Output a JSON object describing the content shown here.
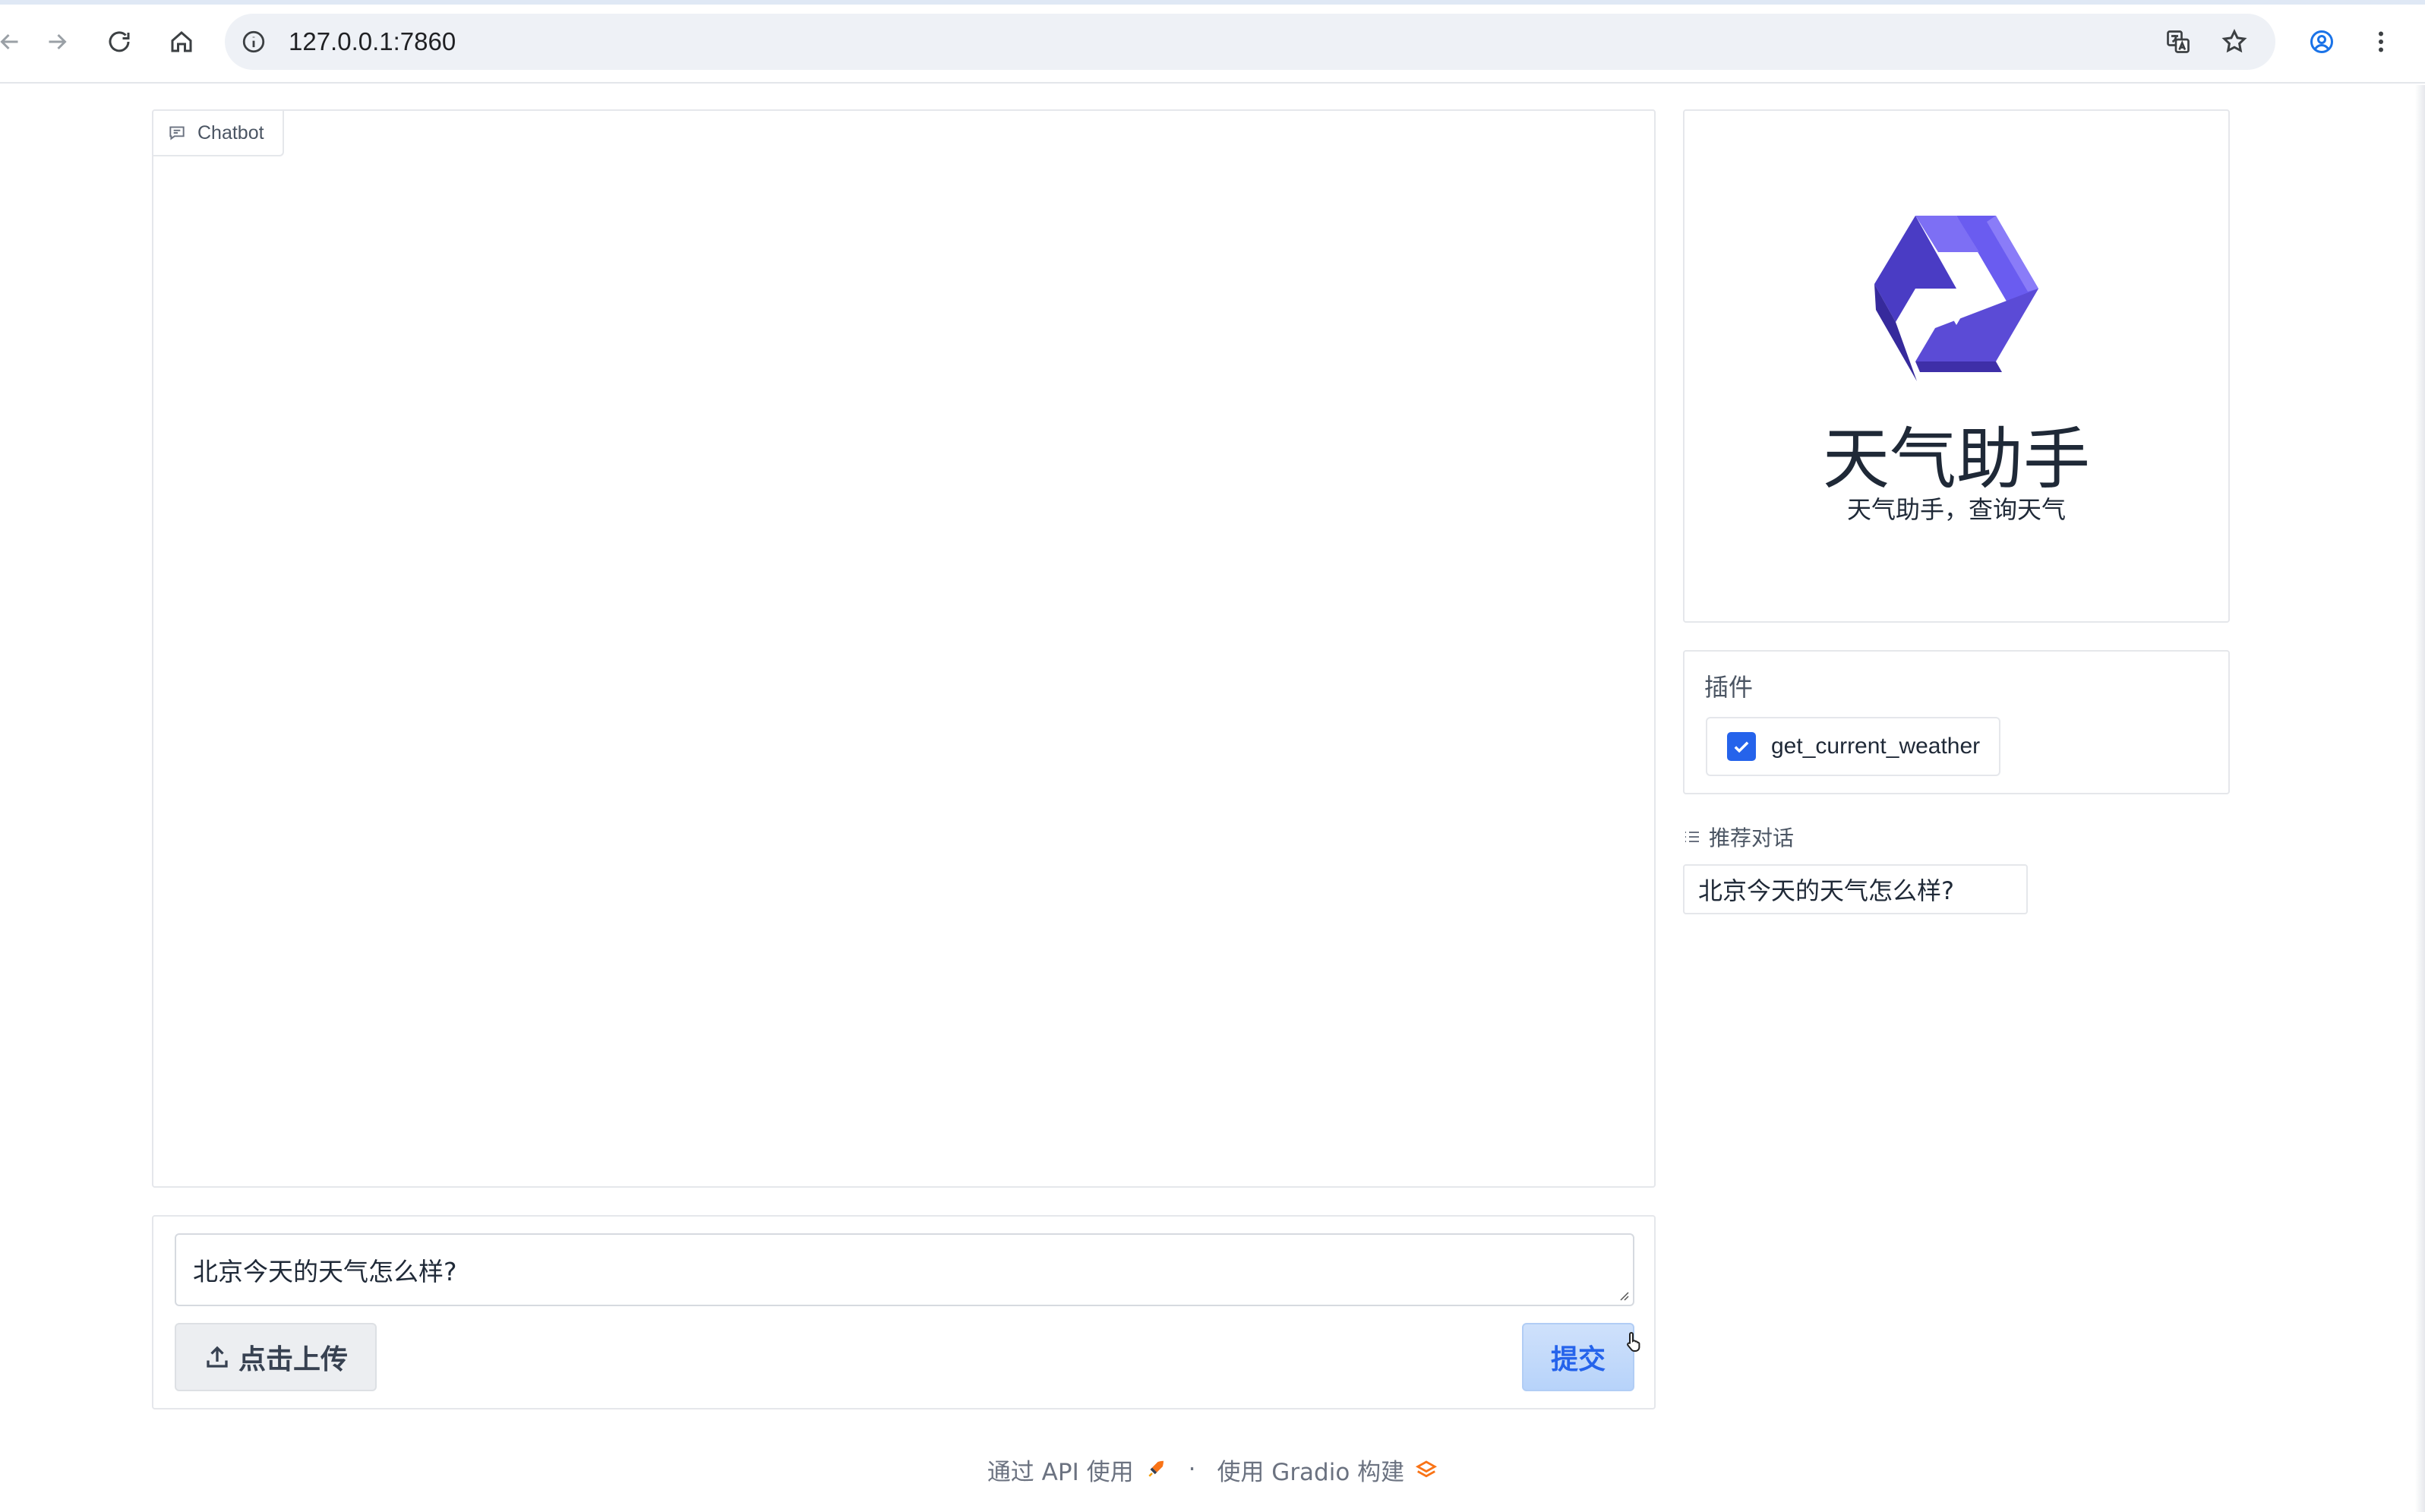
{
  "browser": {
    "url": "127.0.0.1:7860",
    "icons": {
      "back": "back-arrow-icon",
      "forward": "forward-arrow-icon",
      "reload": "reload-icon",
      "home": "home-icon",
      "site_info": "info-icon",
      "translate": "translate-icon",
      "bookmark": "star-icon",
      "profile": "profile-icon",
      "menu": "kebab-menu-icon"
    }
  },
  "chatbot": {
    "label": "Chatbot",
    "icon": "chat-icon"
  },
  "input": {
    "value": "北京今天的天气怎么样?",
    "upload_label": "点击上传",
    "submit_label": "提交"
  },
  "agent": {
    "name": "天气助手",
    "description": "天气助手，查询天气",
    "logo_colors": [
      "#5b4bd6",
      "#6a5cf0",
      "#3e2fa8"
    ]
  },
  "plugins": {
    "title": "插件",
    "items": [
      {
        "label": "get_current_weather",
        "checked": true
      }
    ]
  },
  "examples": {
    "label": "推荐对话",
    "items": [
      "北京今天的天气怎么样?"
    ]
  },
  "footer": {
    "api_text": "通过 API 使用",
    "separator": "·",
    "built_text": "使用 Gradio 构建"
  },
  "colors": {
    "accent": "#2563eb",
    "submit_bg": "#c4dafa",
    "border": "#e5e7eb"
  }
}
